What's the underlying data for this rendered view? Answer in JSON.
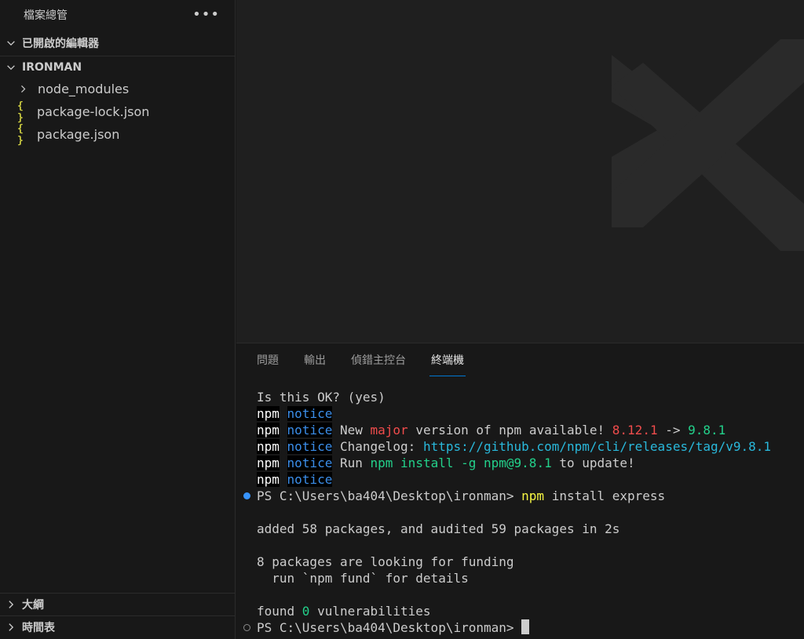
{
  "sidebar": {
    "title": "檔案總管",
    "more_icon": "more-icon",
    "open_editors": "已開啟的編輯器",
    "project": "IRONMAN",
    "files": [
      {
        "name": "node_modules",
        "icon": "chevron-right-icon"
      },
      {
        "name": "package-lock.json",
        "icon": "json-icon",
        "icon_text": "{ }"
      },
      {
        "name": "package.json",
        "icon": "json-icon",
        "icon_text": "{ }"
      }
    ],
    "outline": "大綱",
    "timeline": "時間表"
  },
  "panel": {
    "tabs": [
      "問題",
      "輸出",
      "偵錯主控台",
      "終端機"
    ],
    "active_tab": "終端機"
  },
  "terminal": {
    "l1": "Is this OK? (yes)",
    "npm": "npm",
    "notice": "notice",
    "new_a": " New ",
    "major": "major",
    "new_b": " version of npm available! ",
    "old_ver": "8.12.1",
    "arrow": " -> ",
    "new_ver": "9.8.1",
    "changelog": " Changelog: ",
    "url": "https://github.com/npm/cli/releases/tag/v9.8.1",
    "run": " Run ",
    "install_cmd": "npm install -g npm@9.8.1",
    "to_update": " to update!",
    "prompt": "PS C:\\Users\\ba404\\Desktop\\ironman> ",
    "cmd_npm": "npm",
    "cmd_rest": " install express",
    "added": "added 58 packages, and audited 59 packages in 2s",
    "funding1": "8 packages are looking for funding",
    "funding2": "  run `npm fund` for details",
    "found_a": "found ",
    "found_zero": "0",
    "found_b": " vulnerabilities"
  },
  "colors": {
    "accent": "#0078d4",
    "error_red": "#f14c4c",
    "green": "#23d18b",
    "cyan": "#29b8db",
    "yellow": "#f5f543"
  }
}
